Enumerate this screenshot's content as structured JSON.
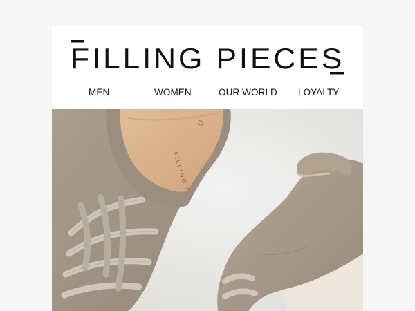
{
  "brand": {
    "logo_text": "FILLING PIECES"
  },
  "nav": {
    "items": [
      {
        "label": "MEN"
      },
      {
        "label": "WOMEN"
      },
      {
        "label": "OUR WORLD"
      },
      {
        "label": "LOYALTY"
      }
    ]
  },
  "hero": {
    "image_subject": "suede-sneakers",
    "tongue_print": "FILLING P"
  },
  "colors": {
    "page_background": "#f6f6f6",
    "card_background": "#ffffff",
    "text": "#111111",
    "suede": "#a39686",
    "leather_lining": "#dcb48f",
    "sole": "#ece6dc"
  }
}
